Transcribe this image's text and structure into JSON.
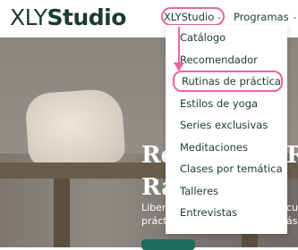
{
  "header": {
    "logo_light": "XLY",
    "logo_bold": "Studio",
    "nav": [
      {
        "label": "XLYStudio",
        "caret": "⌄"
      },
      {
        "label": "Programas",
        "caret": "⌄"
      }
    ]
  },
  "dropdown": {
    "items": [
      "Catálogo",
      "Recomendador",
      "Rutinas de práctica",
      "Estilos de yoga",
      "Series exclusivas",
      "Meditaciones",
      "Clases por temática",
      "Talleres",
      "Entrevistas"
    ],
    "highlighted_index": 2
  },
  "hero": {
    "title_line1_left": "Re",
    "title_line1_right": "R",
    "title_line2_left": "Ra",
    "title_line2_right": "",
    "subtitle_line1_left": "Liber",
    "subtitle_line1_right": "cue",
    "subtitle_line2_left": "práct",
    "subtitle_line2_right": "ás"
  },
  "colors": {
    "brand_dark": "#1b3a30",
    "highlight": "#e8669f",
    "button": "#1f6b5c"
  }
}
